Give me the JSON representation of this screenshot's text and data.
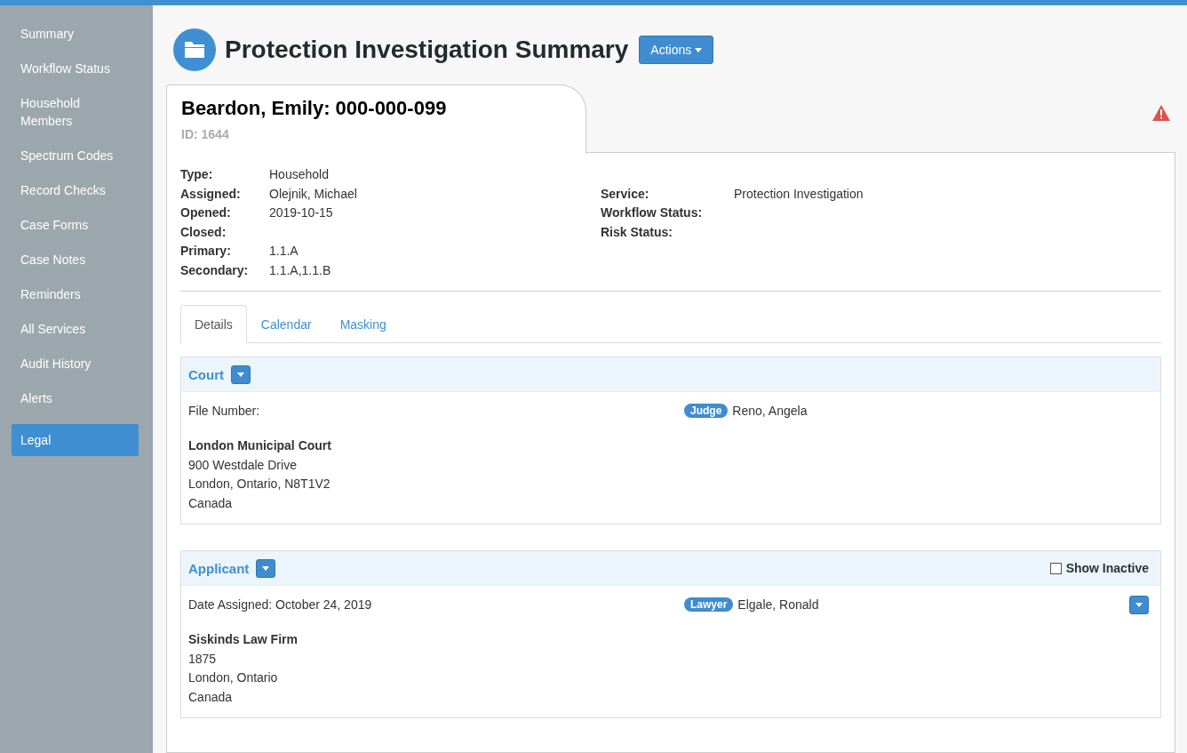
{
  "sidebar": {
    "items": [
      {
        "label": "Summary",
        "selected": false
      },
      {
        "label": "Workflow Status",
        "selected": false
      },
      {
        "label": "Household Members",
        "selected": false
      },
      {
        "label": "Spectrum Codes",
        "selected": false
      },
      {
        "label": "Record Checks",
        "selected": false
      },
      {
        "label": "Case Forms",
        "selected": false
      },
      {
        "label": "Case Notes",
        "selected": false
      },
      {
        "label": "Reminders",
        "selected": false
      },
      {
        "label": "All Services",
        "selected": false
      },
      {
        "label": "Audit History",
        "selected": false
      },
      {
        "label": "Alerts",
        "selected": false
      },
      {
        "label": "Legal",
        "selected": true
      }
    ]
  },
  "header": {
    "title": "Protection Investigation Summary",
    "actions_button": "Actions"
  },
  "record": {
    "name": "Beardon, Emily: 000-000-099",
    "id": "ID: 1644",
    "fields_left": [
      {
        "label": "Type:",
        "value": "Household"
      },
      {
        "label": "Assigned:",
        "value": "Olejnik, Michael"
      },
      {
        "label": "Opened:",
        "value": "2019-10-15"
      },
      {
        "label": "Closed:"
      },
      {
        "label": "Primary:",
        "value": "1.1.A"
      },
      {
        "label": "Secondary:",
        "value": "1.1.A,1.1.B"
      }
    ],
    "fields_right": [
      {
        "label": "Service:",
        "value": "Protection Investigation"
      },
      {
        "label": "Workflow Status:"
      },
      {
        "label": "Risk Status:"
      }
    ]
  },
  "tabs": [
    {
      "label": "Details",
      "selected": true
    },
    {
      "label": "Calendar",
      "selected": false
    },
    {
      "label": "Masking",
      "selected": false
    }
  ],
  "sections": [
    {
      "title": "Court",
      "detail": "File Number:",
      "role": "Judge",
      "person": "Reno, Angela",
      "row_menu": false,
      "org_name": "London Municipal Court",
      "address_lines": [
        "900 Westdale Drive",
        "London, Ontario, N8T1V2",
        "Canada"
      ]
    },
    {
      "title": "Applicant",
      "show_inactive": {
        "label": "Show Inactive",
        "checked": false
      },
      "detail": "Date Assigned: October 24, 2019",
      "role": "Lawyer",
      "person": "Elgale, Ronald",
      "row_menu": true,
      "org_name": "Siskinds Law Firm",
      "address_lines": [
        "1875",
        "London, Ontario",
        "Canada"
      ]
    }
  ]
}
